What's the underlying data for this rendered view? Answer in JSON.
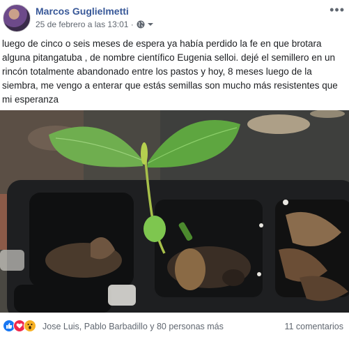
{
  "post": {
    "author": "Marcos Guglielmetti",
    "timestamp": "25 de febrero a las 13:01 ·",
    "more_icon": "more-horizontal-icon",
    "privacy_icon": "globe-icon",
    "text": "luego de cinco o seis meses de espera ya había perdido la fe en que brotara alguna pitangatuba , de nombre científico Eugenia selloi. dejé el semillero en un rincón totalmente abandonado entre los pastos y hoy, 8 meses luego de la siembra, me vengo a enterar que estás semillas son mucho más resistentes que mi esperanza"
  },
  "reactions": {
    "icons": [
      "like-icon",
      "love-icon",
      "wow-icon"
    ],
    "summary": "Jose Luis, Pablo Barbadillo y 80 personas más",
    "comments": "11 comentarios"
  },
  "colors": {
    "author_link": "#385898",
    "meta_text": "#606770",
    "like": "#1877f2",
    "love": "#f0284a",
    "wow": "#f7b125"
  }
}
